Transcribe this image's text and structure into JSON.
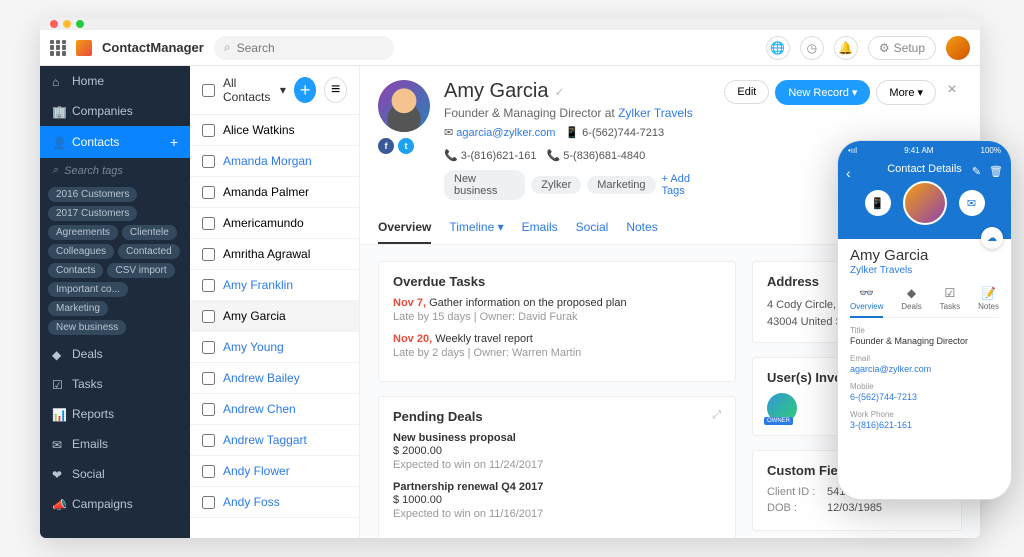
{
  "brand": "ContactManager",
  "search_placeholder": "Search",
  "topbar": {
    "setup": "Setup"
  },
  "sidebar": {
    "items": [
      {
        "icon": "home",
        "label": "Home"
      },
      {
        "icon": "building",
        "label": "Companies"
      },
      {
        "icon": "user",
        "label": "Contacts",
        "active": true,
        "plus": true
      },
      {
        "icon": "deal",
        "label": "Deals"
      },
      {
        "icon": "task",
        "label": "Tasks"
      },
      {
        "icon": "report",
        "label": "Reports"
      },
      {
        "icon": "email",
        "label": "Emails"
      },
      {
        "icon": "social",
        "label": "Social"
      },
      {
        "icon": "campaign",
        "label": "Campaigns"
      }
    ],
    "search_tags": "Search tags",
    "tags": [
      "2016 Customers",
      "2017 Customers",
      "Agreements",
      "Clientele",
      "Colleagues",
      "Contacted",
      "Contacts",
      "CSV import",
      "Important co...",
      "Marketing",
      "New business"
    ]
  },
  "list": {
    "title": "All Contacts",
    "contacts": [
      {
        "name": "Alice Watkins",
        "link": false
      },
      {
        "name": "Amanda Morgan",
        "link": true
      },
      {
        "name": "Amanda Palmer",
        "link": false
      },
      {
        "name": "Americamundo",
        "link": false
      },
      {
        "name": "Amritha Agrawal",
        "link": false
      },
      {
        "name": "Amy Franklin",
        "link": true
      },
      {
        "name": "Amy Garcia",
        "link": false,
        "selected": true
      },
      {
        "name": "Amy Young",
        "link": true
      },
      {
        "name": "Andrew Bailey",
        "link": true
      },
      {
        "name": "Andrew Chen",
        "link": true
      },
      {
        "name": "Andrew Taggart",
        "link": true
      },
      {
        "name": "Andy Flower",
        "link": true
      },
      {
        "name": "Andy Foss",
        "link": true
      }
    ]
  },
  "detail": {
    "name": "Amy Garcia",
    "role_prefix": "Founder & Managing Director at ",
    "company": "Zylker Travels",
    "email": "agarcia@zylker.com",
    "phones": [
      "6-(562)744-7213",
      "3-(816)621-161",
      "5-(836)681-4840"
    ],
    "tags": [
      "New business",
      "Zylker",
      "Marketing"
    ],
    "add_tags": "+ Add Tags",
    "actions": {
      "edit": "Edit",
      "new_record": "New Record",
      "more": "More"
    },
    "tabs": [
      "Overview",
      "Timeline",
      "Emails",
      "Social",
      "Notes"
    ],
    "overdue": {
      "title": "Overdue Tasks",
      "items": [
        {
          "date": "Nov 7,",
          "title": "Gather information on the proposed plan",
          "meta": "Late by 15 days | Owner: David Furak"
        },
        {
          "date": "Nov 20,",
          "title": "Weekly travel report",
          "meta": "Late by 2 days | Owner: Warren Martin"
        }
      ]
    },
    "pending": {
      "title": "Pending Deals",
      "items": [
        {
          "title": "New business proposal",
          "amount": "$ 2000.00",
          "meta": "Expected to win on 11/24/2017"
        },
        {
          "title": "Partnership renewal Q4 2017",
          "amount": "$ 1000.00",
          "meta": "Expected to win on 11/16/2017"
        }
      ]
    },
    "address": {
      "title": "Address",
      "text": "4 Cody Circle, Columbus, Ohio, 43004 United States"
    },
    "users": {
      "title": "User(s) Involved"
    },
    "custom": {
      "title": "Custom Fields",
      "client_id_label": "Client ID :",
      "client_id": "5410",
      "dob_label": "DOB :",
      "dob": "12/03/1985"
    }
  },
  "phone": {
    "time": "9:41 AM",
    "battery": "100%",
    "signal": "•ııl",
    "header": "Contact Details",
    "name": "Amy Garcia",
    "company": "Zylker Travels",
    "tabs": [
      "Overview",
      "Deals",
      "Tasks",
      "Notes"
    ],
    "fields": [
      {
        "label": "Title",
        "value": "Founder & Managing Director",
        "link": false
      },
      {
        "label": "Email",
        "value": "agarcia@zylker.com",
        "link": true
      },
      {
        "label": "Mobile",
        "value": "6-(562)744-7213",
        "link": true
      },
      {
        "label": "Work Phone",
        "value": "3-(816)621-161",
        "link": true
      }
    ]
  }
}
